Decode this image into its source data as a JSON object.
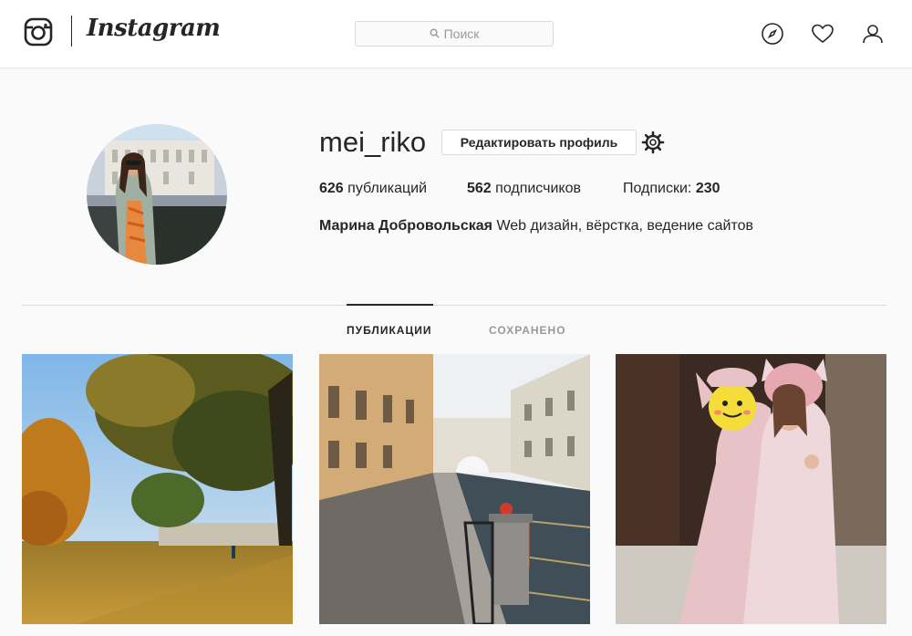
{
  "header": {
    "brand": "Instagram",
    "search_placeholder": "Поиск",
    "icons": [
      "instagram-logo-icon",
      "search-icon",
      "compass-icon",
      "heart-icon",
      "user-icon"
    ]
  },
  "profile": {
    "username": "mei_riko",
    "edit_button": "Редактировать профиль",
    "settings_icon": "gear-icon",
    "posts_count": "626",
    "posts_label": "публикаций",
    "followers_count": "562",
    "followers_label": "подписчиков",
    "following_label": "Подписки:",
    "following_count": "230",
    "full_name": "Марина Добровольская",
    "bio": "Web дизайн, вёрстка, ведение сайтов"
  },
  "tabs": [
    {
      "label": "ПУБЛИКАЦИИ",
      "active": true
    },
    {
      "label": "СОХРАНЕНО",
      "active": false
    }
  ],
  "colors": {
    "text": "#262626",
    "muted": "#999999",
    "border": "#dbdbdb",
    "background": "#fafafa"
  }
}
